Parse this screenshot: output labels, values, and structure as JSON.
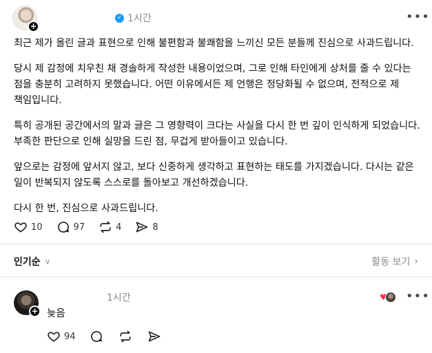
{
  "post": {
    "time": "1시간",
    "paragraphs": [
      "최근 제가 올린 글과 표현으로 인해 불편함과 불쾌함을 느끼신 모든 분들께 진심으로 사과드립니다.",
      "당시 제 감정에 치우친 채 경솔하게 작성한 내용이었으며, 그로 인해 타인에게 상처를 줄 수 있다는 점을 충분히 고려하지 못했습니다. 어떤 이유에서든 제 언행은 정당화될 수 없으며, 전적으로 제 책임입니다.",
      "특히 공개된 공간에서의 말과 글은 그 영향력이 크다는 사실을 다시 한 번 깊이 인식하게 되었습니다. 부족한 판단으로 인해 실망을 드린 점, 무겁게 받아들이고 있습니다.",
      "앞으로는 감정에 앞서지 않고, 보다 신중하게 생각하고 표현하는 태도를 가지겠습니다. 다시는 같은 일이 반복되지 않도록 스스로를 돌아보고 개선하겠습니다.",
      "다시 한 번, 진심으로 사과드립니다."
    ],
    "likes": "10",
    "replies": "97",
    "reposts": "4",
    "shares": "8"
  },
  "replies_bar": {
    "sort_label": "인기순",
    "activity_label": "활동 보기"
  },
  "comment": {
    "time": "1시간",
    "text": "늦음",
    "likes": "94"
  },
  "icons": {
    "verified": "verified-check-icon",
    "more": "more-horizontal-icon",
    "like": "heart-icon",
    "reply": "comment-bubble-icon",
    "repost": "repost-icon",
    "share": "send-icon"
  }
}
